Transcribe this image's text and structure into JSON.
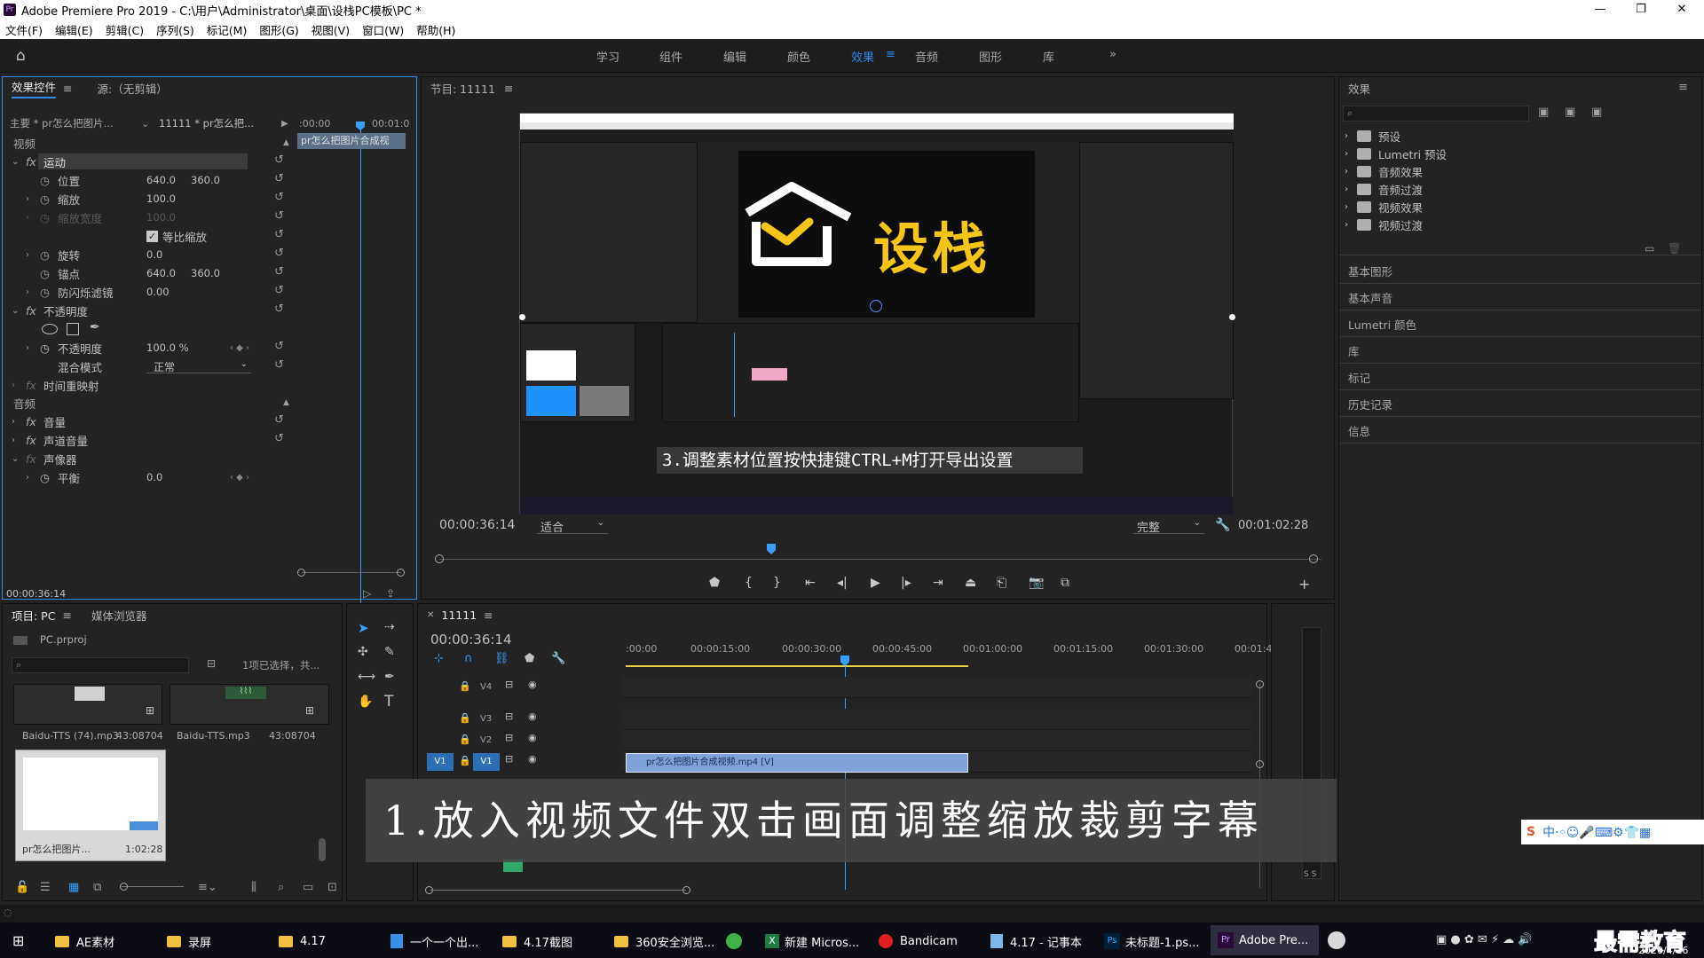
{
  "window": {
    "title": "Adobe Premiere Pro 2019 - C:\\用户\\Administrator\\桌面\\设栈PC模板\\PC *",
    "app_icon": "Pr"
  },
  "menu": [
    "文件(F)",
    "编辑(E)",
    "剪辑(C)",
    "序列(S)",
    "标记(M)",
    "图形(G)",
    "视图(V)",
    "窗口(W)",
    "帮助(H)"
  ],
  "workspaces": [
    "学习",
    "组件",
    "编辑",
    "颜色",
    "效果",
    "音频",
    "图形",
    "库"
  ],
  "active_workspace": "效果",
  "effect_controls": {
    "tab": "效果控件",
    "source_tab": "源:（无剪辑）",
    "master_label": "主要 * pr怎么把图片...",
    "clip_label": "11111 * pr怎么把...",
    "time_start": ":00:00",
    "time_end": "00:01:0",
    "clip_bar": "pr怎么把图片合成视",
    "video_label": "视频",
    "motion": "运动",
    "position_label": "位置",
    "position_x": "640.0",
    "position_y": "360.0",
    "scale_label": "缩放",
    "scale_value": "100.0",
    "scale_width_label": "缩放宽度",
    "scale_width_value": "100.0",
    "uniform_scale": "等比缩放",
    "rotation_label": "旋转",
    "rotation_value": "0.0",
    "anchor_label": "锚点",
    "anchor_x": "640.0",
    "anchor_y": "360.0",
    "flicker_label": "防闪烁滤镜",
    "flicker_value": "0.00",
    "opacity_group": "不透明度",
    "opacity_label": "不透明度",
    "opacity_value": "100.0 %",
    "blend_label": "混合模式",
    "blend_value": "正常",
    "time_remap": "时间重映射",
    "audio_label": "音频",
    "volume": "音量",
    "channel_volume": "声道音量",
    "panner": "声像器",
    "balance_label": "平衡",
    "balance_value": "0.0",
    "timecode": "00:00:36:14"
  },
  "program": {
    "title": "节目: 11111",
    "timecode": "00:00:36:14",
    "fit": "适合",
    "quality": "完整",
    "duration": "00:01:02:28",
    "logo_text": "设栈",
    "inner_caption": "3.调整素材位置按快捷键CTRL+M打开导出设置"
  },
  "effects_panel": {
    "title": "效果",
    "tree": [
      "预设",
      "Lumetri 预设",
      "音频效果",
      "音频过渡",
      "视频效果",
      "视频过渡"
    ],
    "sections": [
      "基本图形",
      "基本声音",
      "Lumetri 颜色",
      "库",
      "标记",
      "历史记录",
      "信息"
    ]
  },
  "project": {
    "tab": "项目: PC",
    "browser_tab": "媒体浏览器",
    "file": "PC.prproj",
    "selection": "1项已选择，共...",
    "items": [
      {
        "name": "Baidu-TTS (74).mp3",
        "duration": "43:08704"
      },
      {
        "name": "Baidu-TTS.mp3",
        "duration": "43:08704"
      },
      {
        "name": "pr怎么把图片...",
        "duration": "1:02:28"
      }
    ]
  },
  "timeline": {
    "tab": "11111",
    "timecode": "00:00:36:14",
    "ruler": [
      ":00:00",
      "00:00:15:00",
      "00:00:30:00",
      "00:00:45:00",
      "00:01:00:00",
      "00:01:15:00",
      "00:01:30:00",
      "00:01:4"
    ],
    "tracks": [
      "V4",
      "V3",
      "V2",
      "V1"
    ],
    "source_patch": "V1",
    "clip_name": "pr怎么把图片合成视频.mp4 [V]",
    "meter_labels": "S S"
  },
  "overlay_caption": "1.放入视频文件双击画面调整缩放裁剪字幕",
  "watermark": {
    "brand": "最需教育",
    "date": "2020/4/16"
  },
  "taskbar": {
    "items": [
      "AE素材",
      "录屏",
      "4.17",
      "一个一个出...",
      "4.17截图",
      "360安全浏览...",
      "新建 Micros...",
      "Bandicam",
      "4.17 - 记事本",
      "未标题-1.ps...",
      "Adobe Pre..."
    ]
  },
  "colors": {
    "accent": "#2d8ceb",
    "clip": "#7fa3d8",
    "panel": "#232323",
    "playhead": "#3aa0ff"
  }
}
